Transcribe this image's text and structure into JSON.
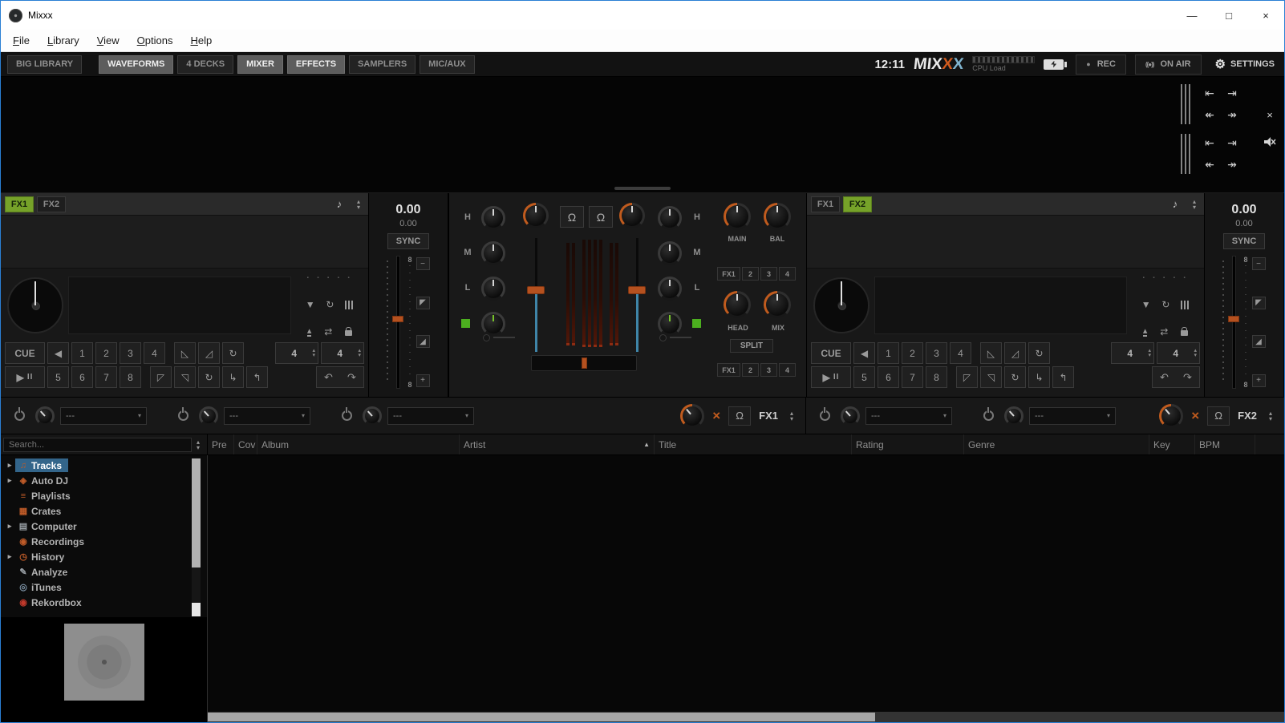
{
  "colors": {
    "accent_orange": "#c05b1e",
    "accent_green": "#76a229",
    "accent_blue": "#3f85a8",
    "selection_blue": "#33658a"
  },
  "window": {
    "title": "Mixxx"
  },
  "menu": {
    "items": [
      "File",
      "Library",
      "View",
      "Options",
      "Help"
    ]
  },
  "toolbar": {
    "big_library": "BIG LIBRARY",
    "views": [
      {
        "label": "WAVEFORMS",
        "active": true
      },
      {
        "label": "4 DECKS",
        "active": false
      },
      {
        "label": "MIXER",
        "active": true
      },
      {
        "label": "EFFECTS",
        "active": true
      },
      {
        "label": "SAMPLERS",
        "active": false
      },
      {
        "label": "MIC/AUX",
        "active": false
      }
    ],
    "clock": "12:11",
    "logo_letters": [
      "M",
      "I",
      "X",
      "X",
      "X"
    ],
    "cpu_label": "CPU Load",
    "rec_label": "REC",
    "on_air_label": "ON AIR",
    "settings_label": "SETTINGS"
  },
  "decks": {
    "left": {
      "fx1": "FX1",
      "fx1_active": true,
      "fx2": "FX2",
      "fx2_active": false,
      "bpm": "0.00",
      "rate": "0.00",
      "sync_label": "SYNC",
      "cue_label": "CUE",
      "hotcues_row1": [
        "1",
        "2",
        "3",
        "4"
      ],
      "hotcues_row2": [
        "5",
        "6",
        "7",
        "8"
      ],
      "beatloop_size": "4",
      "beatjump_size": "4",
      "pitch_range_top": "8",
      "pitch_range_bottom": "8"
    },
    "right": {
      "fx1": "FX1",
      "fx1_active": false,
      "fx2": "FX2",
      "fx2_active": true,
      "bpm": "0.00",
      "rate": "0.00",
      "sync_label": "SYNC",
      "cue_label": "CUE",
      "hotcues_row1": [
        "1",
        "2",
        "3",
        "4"
      ],
      "hotcues_row2": [
        "5",
        "6",
        "7",
        "8"
      ],
      "beatloop_size": "4",
      "beatjump_size": "4",
      "pitch_range_top": "8",
      "pitch_range_bottom": "8"
    }
  },
  "mixer": {
    "eq_labels": [
      "H",
      "M",
      "L"
    ],
    "main_label": "MAIN",
    "bal_label": "BAL",
    "head_label": "HEAD",
    "mix_label": "MIX",
    "split_label": "SPLIT",
    "fx_assign": [
      "FX1",
      "2",
      "3",
      "4"
    ]
  },
  "effects": {
    "unit1": {
      "label": "FX1",
      "slots": [
        "---",
        "---",
        "---"
      ]
    },
    "unit2": {
      "label": "FX2",
      "slots": [
        "---",
        "---"
      ]
    }
  },
  "library": {
    "search_placeholder": "Search...",
    "columns": [
      "Pre",
      "Cov",
      "Album",
      "Artist",
      "Title",
      "Rating",
      "Genre",
      "Key",
      "BPM"
    ],
    "sort_column": "Artist",
    "sidebar": [
      {
        "label": "Tracks",
        "arrow": "▸",
        "selected": true,
        "icon": "♫",
        "icon_color": "#bf5b28"
      },
      {
        "label": "Auto DJ",
        "arrow": "▸",
        "icon": "◈",
        "icon_color": "#bf5b28"
      },
      {
        "label": "Playlists",
        "arrow": "",
        "icon": "≡",
        "icon_color": "#bf5b28"
      },
      {
        "label": "Crates",
        "arrow": "",
        "icon": "▦",
        "icon_color": "#bf5b28"
      },
      {
        "label": "Computer",
        "arrow": "▸",
        "icon": "▤",
        "icon_color": "#9aa0a6"
      },
      {
        "label": "Recordings",
        "arrow": "",
        "icon": "◉",
        "icon_color": "#bf5b28"
      },
      {
        "label": "History",
        "arrow": "▸",
        "icon": "◷",
        "icon_color": "#bf5b28"
      },
      {
        "label": "Analyze",
        "arrow": "",
        "icon": "✎",
        "icon_color": "#9aa0a6"
      },
      {
        "label": "iTunes",
        "arrow": "",
        "icon": "◎",
        "icon_color": "#7d93a6"
      },
      {
        "label": "Rekordbox",
        "arrow": "",
        "icon": "◉",
        "icon_color": "#c0392b"
      }
    ]
  },
  "icons": {
    "minimize": "—",
    "maximize": "□",
    "close": "×",
    "note": "♪",
    "up": "▴",
    "down": "▾",
    "prev": "◀",
    "play": "▶",
    "pause": "II",
    "loop_in": "◺",
    "loop_out": "◿",
    "reloop": "↻",
    "slip_in": "◸",
    "slip_out": "◹",
    "indent": "↳",
    "outdent": "↰",
    "jump_back": "↶",
    "jump_fwd": "↷",
    "shuffle": "⇄",
    "tri_down": "▼",
    "repeat": "↻",
    "dots": "· · · · ·",
    "minus": "−",
    "plus": "+",
    "nudge_up": "◤",
    "nudge_down": "◢",
    "headphone": "Ω",
    "cross": "×",
    "gear": "⚙",
    "rec_dot": "●",
    "broadcast": "((●))",
    "sort_asc": "▲",
    "skip_start": "⇤",
    "skip_end": "⇥",
    "rew": "↞",
    "ffwd": "↠"
  }
}
